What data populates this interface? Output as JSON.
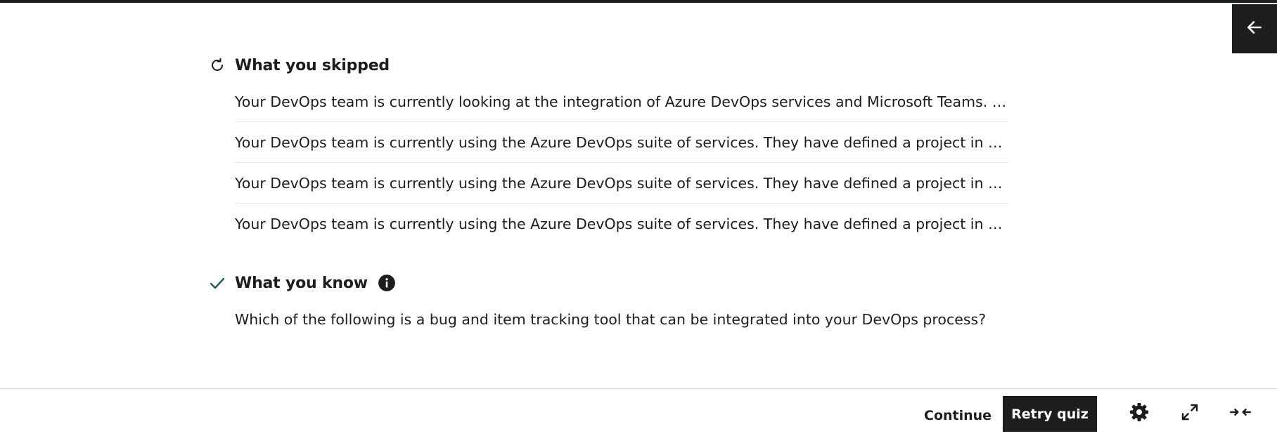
{
  "skipped": {
    "title": "What you skipped",
    "items": [
      "Your DevOps team is currently looking at the integration of Azure DevOps services and Microsoft Teams. Which of the following is true?",
      "Your DevOps team is currently using the Azure DevOps suite of services. They have defined a project in Azure Boards.",
      "Your DevOps team is currently using the Azure DevOps suite of services. They have defined a project in Azure Boards for tracking.",
      "Your DevOps team is currently using the Azure DevOps suite of services. They have defined a project in Azure Boards for planning."
    ]
  },
  "known": {
    "title": "What you know",
    "items": [
      "Which of the following is a bug and item tracking tool that can be integrated into your DevOps process?"
    ]
  },
  "footer": {
    "continue_label": "Continue",
    "retry_label": "Retry quiz"
  },
  "icons": {
    "back": "arrow-left-icon",
    "skipped": "retry-arrow-icon",
    "known": "checkmark-icon",
    "info": "info-icon",
    "settings": "gear-icon",
    "fullscreen": "expand-icon",
    "collapse": "collapse-sidebar-icon"
  },
  "colors": {
    "dark": "#1c1d1f",
    "check": "#1e6055",
    "divider": "#d1d7dc"
  }
}
